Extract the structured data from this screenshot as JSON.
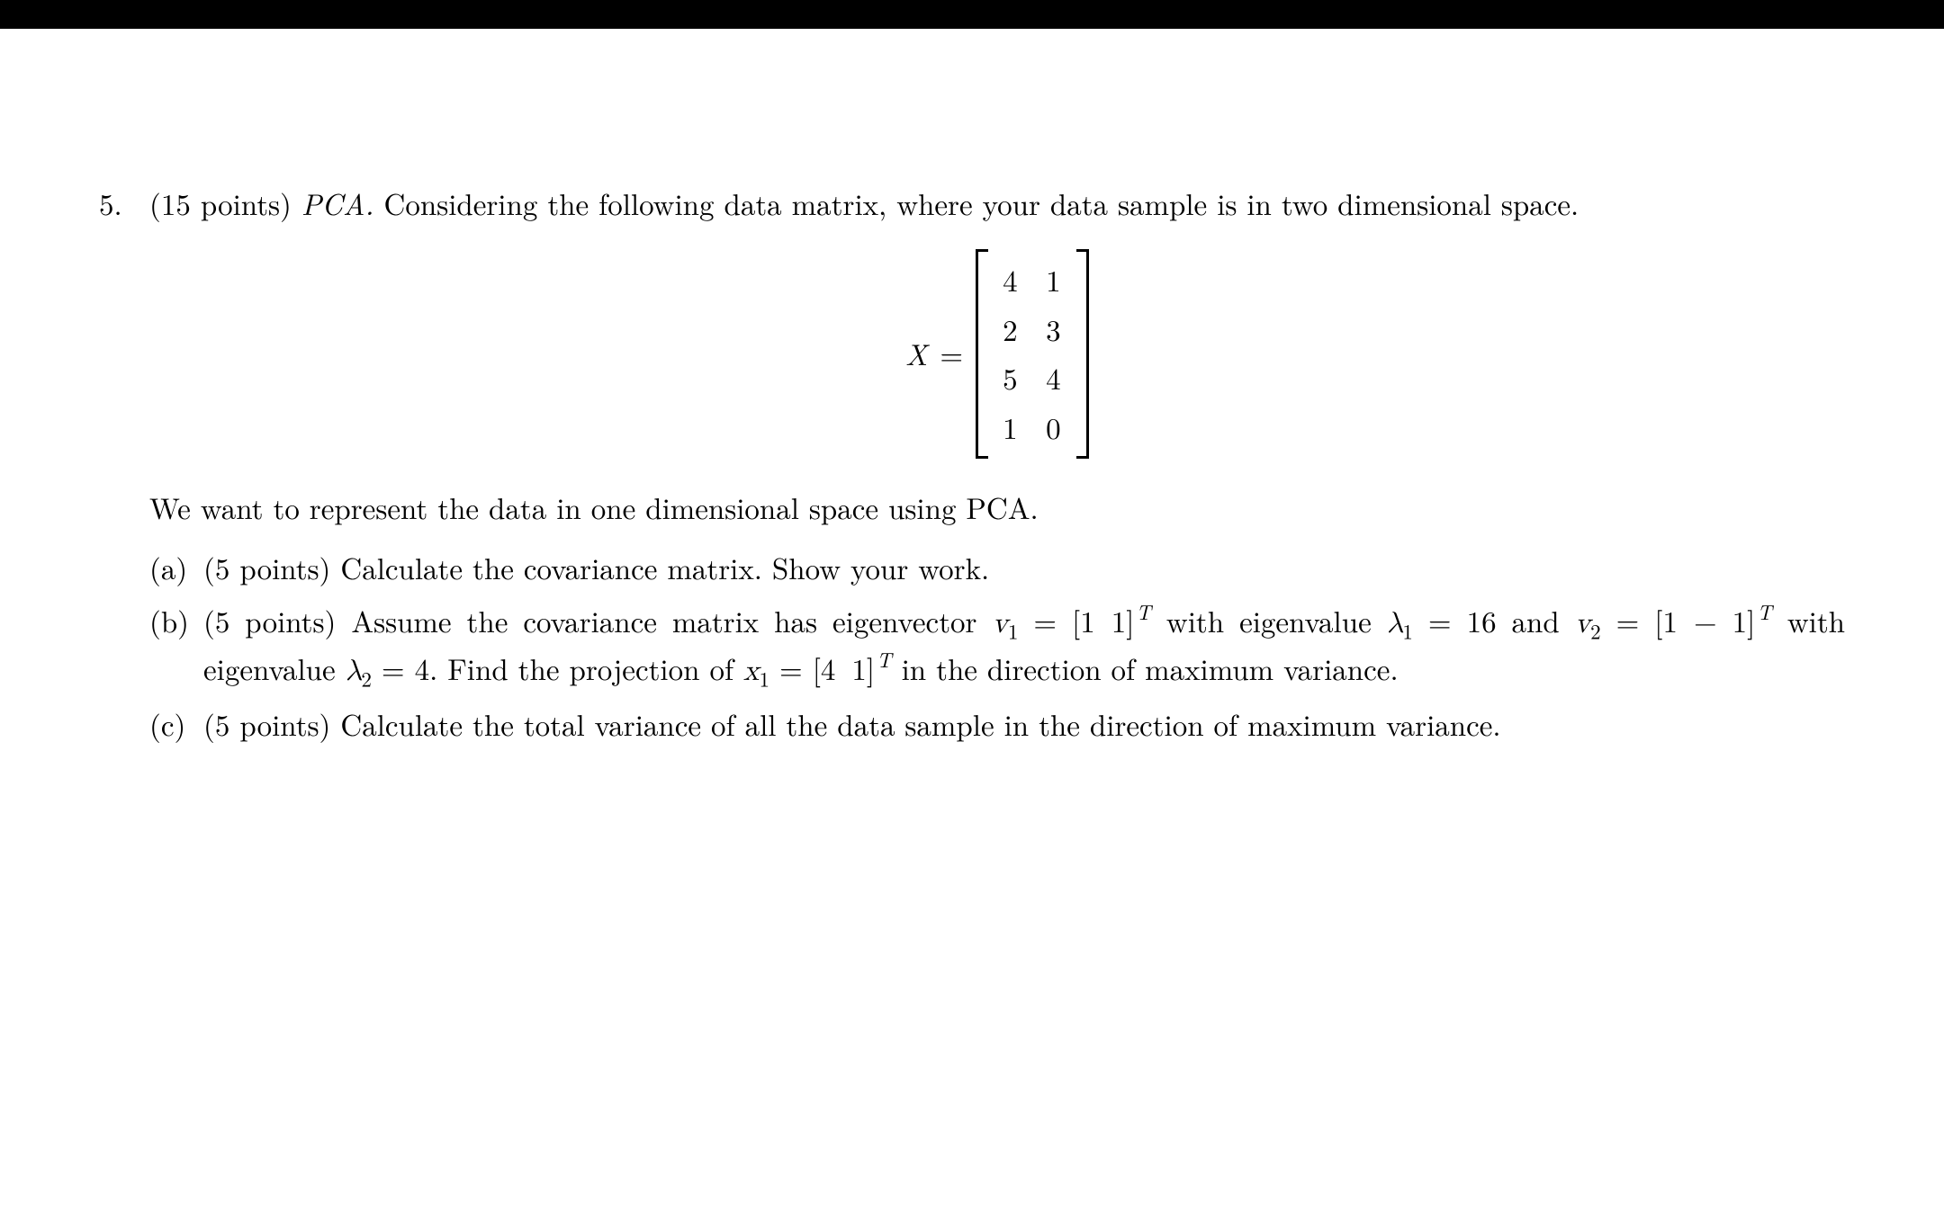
{
  "problem": {
    "number": "5.",
    "points": "(15 points)",
    "title": "PCA.",
    "intro": " Considering the following data matrix, where your data sample is in two dimensional space.",
    "matrix_var": "X",
    "eq": "=",
    "matrix": {
      "r1c1": "4",
      "r1c2": "1",
      "r2c1": "2",
      "r2c2": "3",
      "r3c1": "5",
      "r3c2": "4",
      "r4c1": "1",
      "r4c2": "0"
    },
    "line2": "We want to represent the data in one dimensional space using PCA.",
    "parts": {
      "a": {
        "label": "(a)",
        "points": "(5 points)",
        "text": " Calculate the covariance matrix. Show your work."
      },
      "b": {
        "label": "(b)",
        "points": "(5 points)",
        "pre": " Assume the covariance matrix has eigenvector ",
        "v1": "v",
        "v1_sub": "1",
        "eq1": " = ",
        "vec1_open": "[",
        "vec1_a": "1",
        "vec1_b": "1",
        "vec1_close": "]",
        "transpose": "T",
        "with_eig": " with eigenvalue ",
        "lambda1": "λ",
        "lambda1_sub": "1",
        "eq2": " = 16 and ",
        "v2": "v",
        "v2_sub": "2",
        "eq3": " = ",
        "vec2_open": "[",
        "vec2_a": "1",
        "vec2_b": "− 1",
        "vec2_close": "]",
        "with_eig2": " with eigenvalue ",
        "lambda2": "λ",
        "lambda2_sub": "2",
        "eq4": " = 4. Find the projection of ",
        "x1": "x",
        "x1_sub": "1",
        "eq5": " = ",
        "vec3_open": "[",
        "vec3_a": "4",
        "vec3_b": "1",
        "vec3_close": "]",
        "tail": " in the direction of maximum variance."
      },
      "c": {
        "label": "(c)",
        "points": "(5 points)",
        "text": " Calculate the total variance of all the data sample in the direction of maximum variance."
      }
    }
  }
}
